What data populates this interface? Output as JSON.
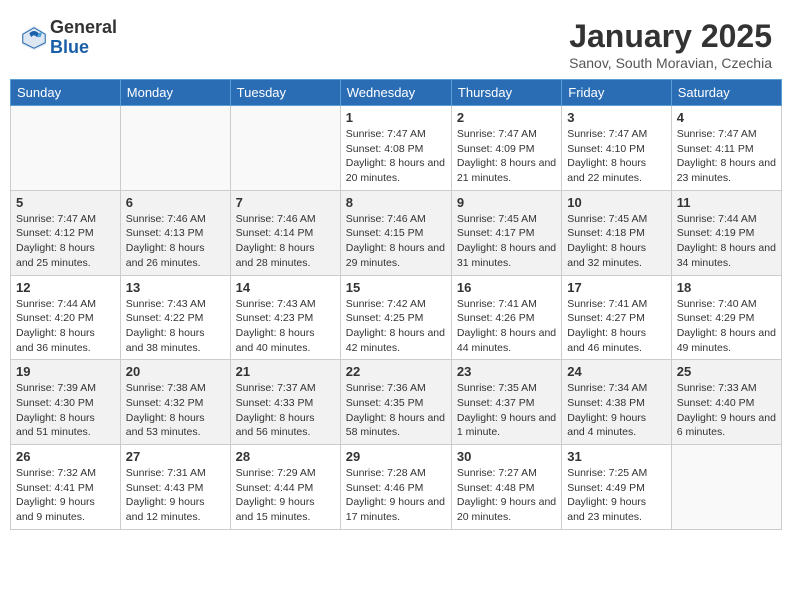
{
  "header": {
    "logo_general": "General",
    "logo_blue": "Blue",
    "title": "January 2025",
    "subtitle": "Sanov, South Moravian, Czechia"
  },
  "weekdays": [
    "Sunday",
    "Monday",
    "Tuesday",
    "Wednesday",
    "Thursday",
    "Friday",
    "Saturday"
  ],
  "weeks": [
    [
      {
        "day": "",
        "sunrise": "",
        "sunset": "",
        "daylight": "",
        "empty": true
      },
      {
        "day": "",
        "sunrise": "",
        "sunset": "",
        "daylight": "",
        "empty": true
      },
      {
        "day": "",
        "sunrise": "",
        "sunset": "",
        "daylight": "",
        "empty": true
      },
      {
        "day": "1",
        "sunrise": "Sunrise: 7:47 AM",
        "sunset": "Sunset: 4:08 PM",
        "daylight": "Daylight: 8 hours and 20 minutes."
      },
      {
        "day": "2",
        "sunrise": "Sunrise: 7:47 AM",
        "sunset": "Sunset: 4:09 PM",
        "daylight": "Daylight: 8 hours and 21 minutes."
      },
      {
        "day": "3",
        "sunrise": "Sunrise: 7:47 AM",
        "sunset": "Sunset: 4:10 PM",
        "daylight": "Daylight: 8 hours and 22 minutes."
      },
      {
        "day": "4",
        "sunrise": "Sunrise: 7:47 AM",
        "sunset": "Sunset: 4:11 PM",
        "daylight": "Daylight: 8 hours and 23 minutes."
      }
    ],
    [
      {
        "day": "5",
        "sunrise": "Sunrise: 7:47 AM",
        "sunset": "Sunset: 4:12 PM",
        "daylight": "Daylight: 8 hours and 25 minutes."
      },
      {
        "day": "6",
        "sunrise": "Sunrise: 7:46 AM",
        "sunset": "Sunset: 4:13 PM",
        "daylight": "Daylight: 8 hours and 26 minutes."
      },
      {
        "day": "7",
        "sunrise": "Sunrise: 7:46 AM",
        "sunset": "Sunset: 4:14 PM",
        "daylight": "Daylight: 8 hours and 28 minutes."
      },
      {
        "day": "8",
        "sunrise": "Sunrise: 7:46 AM",
        "sunset": "Sunset: 4:15 PM",
        "daylight": "Daylight: 8 hours and 29 minutes."
      },
      {
        "day": "9",
        "sunrise": "Sunrise: 7:45 AM",
        "sunset": "Sunset: 4:17 PM",
        "daylight": "Daylight: 8 hours and 31 minutes."
      },
      {
        "day": "10",
        "sunrise": "Sunrise: 7:45 AM",
        "sunset": "Sunset: 4:18 PM",
        "daylight": "Daylight: 8 hours and 32 minutes."
      },
      {
        "day": "11",
        "sunrise": "Sunrise: 7:44 AM",
        "sunset": "Sunset: 4:19 PM",
        "daylight": "Daylight: 8 hours and 34 minutes."
      }
    ],
    [
      {
        "day": "12",
        "sunrise": "Sunrise: 7:44 AM",
        "sunset": "Sunset: 4:20 PM",
        "daylight": "Daylight: 8 hours and 36 minutes."
      },
      {
        "day": "13",
        "sunrise": "Sunrise: 7:43 AM",
        "sunset": "Sunset: 4:22 PM",
        "daylight": "Daylight: 8 hours and 38 minutes."
      },
      {
        "day": "14",
        "sunrise": "Sunrise: 7:43 AM",
        "sunset": "Sunset: 4:23 PM",
        "daylight": "Daylight: 8 hours and 40 minutes."
      },
      {
        "day": "15",
        "sunrise": "Sunrise: 7:42 AM",
        "sunset": "Sunset: 4:25 PM",
        "daylight": "Daylight: 8 hours and 42 minutes."
      },
      {
        "day": "16",
        "sunrise": "Sunrise: 7:41 AM",
        "sunset": "Sunset: 4:26 PM",
        "daylight": "Daylight: 8 hours and 44 minutes."
      },
      {
        "day": "17",
        "sunrise": "Sunrise: 7:41 AM",
        "sunset": "Sunset: 4:27 PM",
        "daylight": "Daylight: 8 hours and 46 minutes."
      },
      {
        "day": "18",
        "sunrise": "Sunrise: 7:40 AM",
        "sunset": "Sunset: 4:29 PM",
        "daylight": "Daylight: 8 hours and 49 minutes."
      }
    ],
    [
      {
        "day": "19",
        "sunrise": "Sunrise: 7:39 AM",
        "sunset": "Sunset: 4:30 PM",
        "daylight": "Daylight: 8 hours and 51 minutes."
      },
      {
        "day": "20",
        "sunrise": "Sunrise: 7:38 AM",
        "sunset": "Sunset: 4:32 PM",
        "daylight": "Daylight: 8 hours and 53 minutes."
      },
      {
        "day": "21",
        "sunrise": "Sunrise: 7:37 AM",
        "sunset": "Sunset: 4:33 PM",
        "daylight": "Daylight: 8 hours and 56 minutes."
      },
      {
        "day": "22",
        "sunrise": "Sunrise: 7:36 AM",
        "sunset": "Sunset: 4:35 PM",
        "daylight": "Daylight: 8 hours and 58 minutes."
      },
      {
        "day": "23",
        "sunrise": "Sunrise: 7:35 AM",
        "sunset": "Sunset: 4:37 PM",
        "daylight": "Daylight: 9 hours and 1 minute."
      },
      {
        "day": "24",
        "sunrise": "Sunrise: 7:34 AM",
        "sunset": "Sunset: 4:38 PM",
        "daylight": "Daylight: 9 hours and 4 minutes."
      },
      {
        "day": "25",
        "sunrise": "Sunrise: 7:33 AM",
        "sunset": "Sunset: 4:40 PM",
        "daylight": "Daylight: 9 hours and 6 minutes."
      }
    ],
    [
      {
        "day": "26",
        "sunrise": "Sunrise: 7:32 AM",
        "sunset": "Sunset: 4:41 PM",
        "daylight": "Daylight: 9 hours and 9 minutes."
      },
      {
        "day": "27",
        "sunrise": "Sunrise: 7:31 AM",
        "sunset": "Sunset: 4:43 PM",
        "daylight": "Daylight: 9 hours and 12 minutes."
      },
      {
        "day": "28",
        "sunrise": "Sunrise: 7:29 AM",
        "sunset": "Sunset: 4:44 PM",
        "daylight": "Daylight: 9 hours and 15 minutes."
      },
      {
        "day": "29",
        "sunrise": "Sunrise: 7:28 AM",
        "sunset": "Sunset: 4:46 PM",
        "daylight": "Daylight: 9 hours and 17 minutes."
      },
      {
        "day": "30",
        "sunrise": "Sunrise: 7:27 AM",
        "sunset": "Sunset: 4:48 PM",
        "daylight": "Daylight: 9 hours and 20 minutes."
      },
      {
        "day": "31",
        "sunrise": "Sunrise: 7:25 AM",
        "sunset": "Sunset: 4:49 PM",
        "daylight": "Daylight: 9 hours and 23 minutes."
      },
      {
        "day": "",
        "sunrise": "",
        "sunset": "",
        "daylight": "",
        "empty": true
      }
    ]
  ]
}
